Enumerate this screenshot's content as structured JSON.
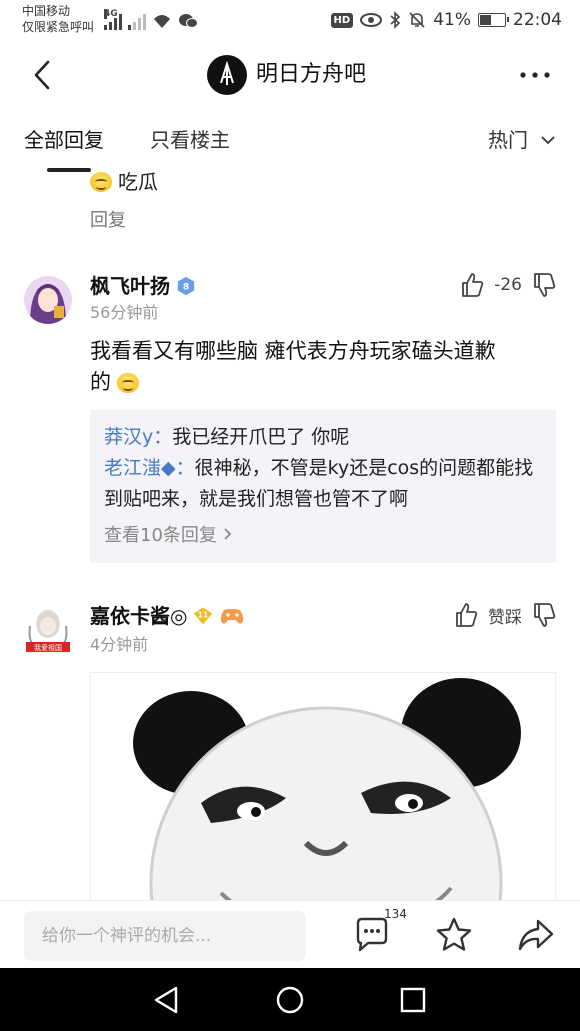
{
  "status_bar": {
    "carrier_line1": "中国移动",
    "carrier_line2": "仅限紧急呼叫",
    "network": "4G",
    "hd": "HD",
    "battery": "41%",
    "battery_level": 0.41,
    "time": "22:04"
  },
  "header": {
    "title": "明日方舟吧",
    "back_icon": "back-arrow-icon",
    "more_icon": "more-dots-icon"
  },
  "tabs": {
    "all": "全部回复",
    "owner_only": "只看楼主",
    "sort": "热门"
  },
  "previous_comment": {
    "text": "吃瓜",
    "reply": "回复"
  },
  "posts": [
    {
      "username": "枫飞叶扬",
      "level": "8",
      "time": "56分钟前",
      "vote": "-26",
      "text_line1": "我看看又有哪些脑 瘫代表方舟玩家磕头道歉",
      "text_line2": "的",
      "sub_replies": [
        {
          "name": "莽汉y：",
          "text": "我已经开爪巴了 你呢"
        },
        {
          "name": "老江滍◆：",
          "text": "很神秘，不管是ky还是cos的问题都能找到贴吧来，就是我们想管也管不了啊"
        }
      ],
      "more_replies": "查看10条回复"
    },
    {
      "username": "嘉依卡酱◎",
      "level": "11",
      "time": "4分钟前",
      "vote": "赞踩",
      "avatar_caption": "我爱祖国"
    }
  ],
  "bottom_bar": {
    "placeholder": "给你一个神评的机会...",
    "comment_count": "134"
  },
  "colors": {
    "accent_blue": "#4a78c3",
    "subbox_bg": "#f4f3f7",
    "badge_blue": "#6a9ee8",
    "badge_gold": "#f1b81f"
  }
}
